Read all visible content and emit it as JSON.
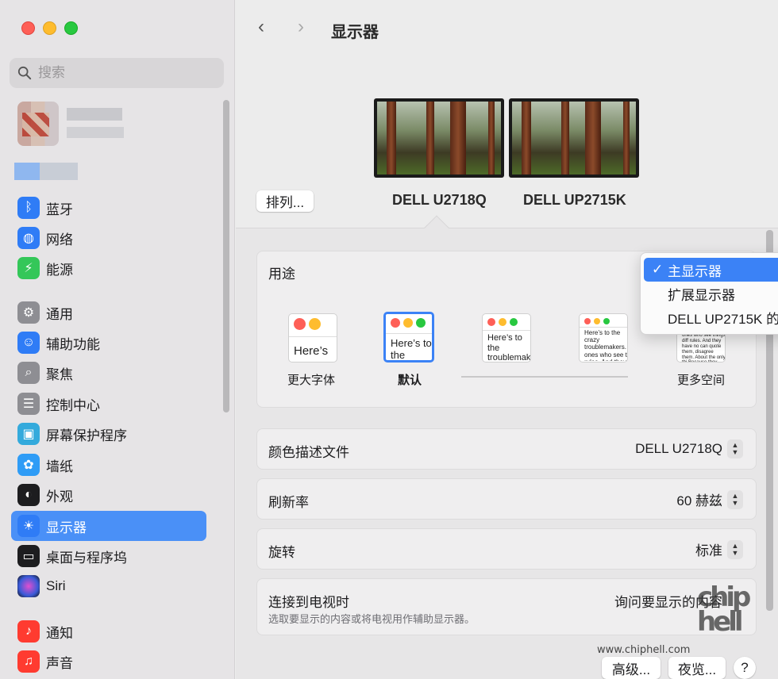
{
  "sidebar": {
    "search_placeholder": "搜索",
    "items": [
      {
        "label": "蓝牙",
        "icon": "bluetooth-icon",
        "color": "#2f7cf6"
      },
      {
        "label": "网络",
        "icon": "globe-icon",
        "color": "#2f7cf6"
      },
      {
        "label": "能源",
        "icon": "bolt-icon",
        "color": "#34c759"
      },
      {
        "label": "通用",
        "icon": "gear-icon",
        "color": "#8e8e93"
      },
      {
        "label": "辅助功能",
        "icon": "accessibility-icon",
        "color": "#2f7cf6"
      },
      {
        "label": "聚焦",
        "icon": "magnifier-icon",
        "color": "#8e8e93"
      },
      {
        "label": "控制中心",
        "icon": "toggles-icon",
        "color": "#8e8e93"
      },
      {
        "label": "屏幕保护程序",
        "icon": "screensaver-icon",
        "color": "#34aadc"
      },
      {
        "label": "墙纸",
        "icon": "flower-icon",
        "color": "#2f9cf6"
      },
      {
        "label": "外观",
        "icon": "appearance-icon",
        "color": "#1d1d1f"
      },
      {
        "label": "显示器",
        "icon": "sun-icon",
        "color": "#2f7cf6"
      },
      {
        "label": "桌面与程序坞",
        "icon": "dock-icon",
        "color": "#1d1d1f"
      },
      {
        "label": "Siri",
        "icon": "siri-icon",
        "color": "#6a3fd8"
      },
      {
        "label": "通知",
        "icon": "bell-icon",
        "color": "#ff3b30"
      },
      {
        "label": "声音",
        "icon": "speaker-icon",
        "color": "#ff3b30"
      }
    ]
  },
  "header": {
    "title": "显示器",
    "back": "‹",
    "forward": "›"
  },
  "displays": {
    "arrange_label": "排列...",
    "monitors": [
      "DELL U2718Q",
      "DELL UP2715K"
    ]
  },
  "usage": {
    "label": "用途",
    "dropdown": [
      "主显示器",
      "扩展显示器",
      "DELL UP2715K 的"
    ],
    "selected": "主显示器",
    "check": "✓"
  },
  "resolution": {
    "thumbs": [
      {
        "text": "Here’s"
      },
      {
        "text": "Here’s to the troublem"
      },
      {
        "text": "Here’s to the troublemakers. ones who"
      },
      {
        "text": "Here’s to the crazy troublemakers. ones who see t rules. And they"
      },
      {
        "text": "ones who see things diff rules. And they have no can quote them, disagree them. About the only thi Because they change thi"
      }
    ],
    "larger_text": "更大字体",
    "default": "默认",
    "more_space": "更多空间"
  },
  "rows": {
    "color_profile": {
      "label": "颜色描述文件",
      "value": "DELL U2718Q"
    },
    "refresh_rate": {
      "label": "刷新率",
      "value": "60 赫兹"
    },
    "rotation": {
      "label": "旋转",
      "value": "标准"
    },
    "tv": {
      "label": "连接到电视时",
      "sub": "选取要显示的内容或将电视用作辅助显示器。",
      "value": "询问要显示的内容"
    }
  },
  "footer": {
    "advanced": "高级...",
    "night_shift": "夜览...",
    "help": "?"
  },
  "watermark": {
    "url": "www.chiphell.com",
    "logo": "chip hell"
  }
}
